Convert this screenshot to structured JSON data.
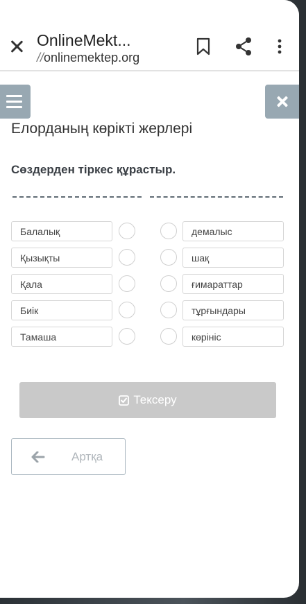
{
  "browser": {
    "site_title": "OnlineMekt...",
    "url_prefix": "//",
    "url": "onlinemektep.org",
    "icons": [
      "close-icon",
      "bookmark-icon",
      "share-icon",
      "more-vert-icon"
    ]
  },
  "lesson": {
    "title": "Елорданың көрікті жерлері",
    "task": "Сөздерден тіркес құрастыр."
  },
  "left_words": [
    "Балалық",
    "Қызықты",
    "Қала",
    "Биік",
    "Тамаша"
  ],
  "right_words": [
    "демалыс",
    "шақ",
    "ғимараттар",
    "тұрғындары",
    "көрініс"
  ],
  "buttons": {
    "check_label": "Тексеру",
    "back_label": "Артқа"
  },
  "colors": {
    "side_button": "#98a8b2",
    "check_button_disabled": "#c9c9c9",
    "back_border": "#a9b6bf"
  }
}
